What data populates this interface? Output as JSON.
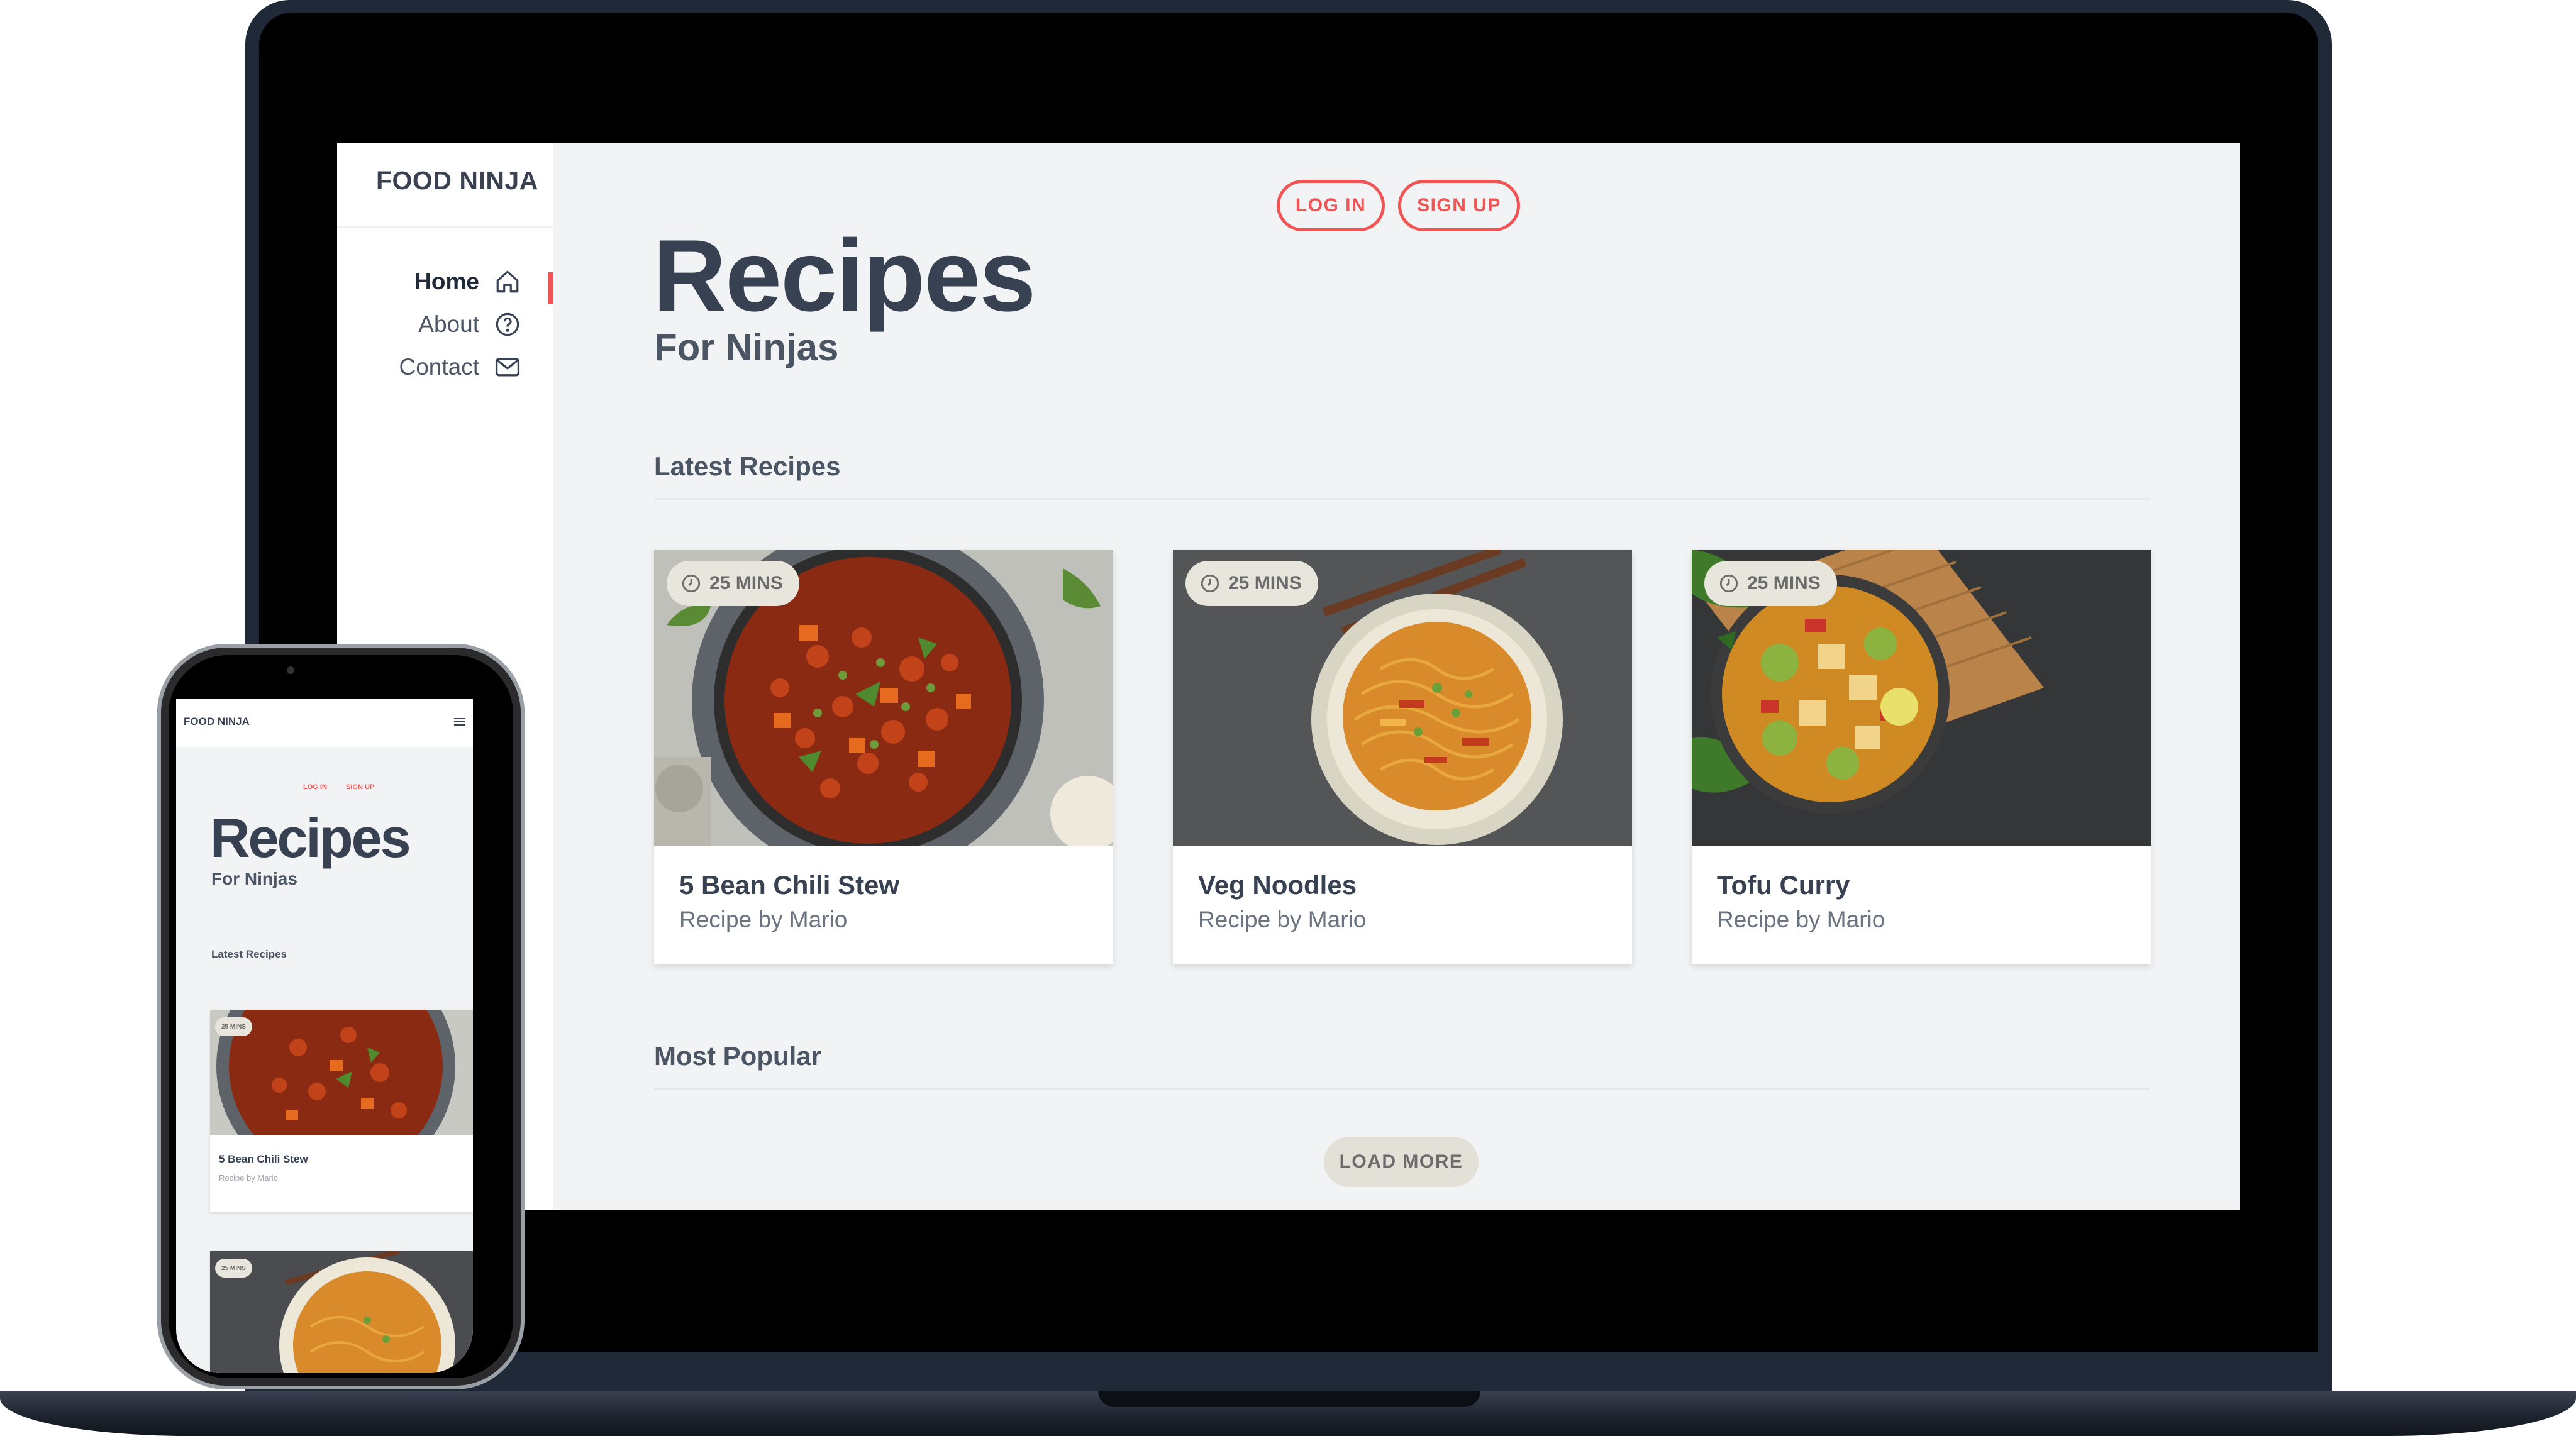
{
  "brand": "FOOD NINJA",
  "nav": [
    {
      "label": "Home",
      "icon": "home-icon",
      "active": true
    },
    {
      "label": "About",
      "icon": "question-circle-icon",
      "active": false
    },
    {
      "label": "Contact",
      "icon": "mail-icon",
      "active": false
    }
  ],
  "auth": {
    "login": "LOG IN",
    "signup": "SIGN UP"
  },
  "hero": {
    "title": "Recipes",
    "subtitle": "For Ninjas"
  },
  "sections": {
    "latest": "Latest Recipes",
    "popular": "Most Popular"
  },
  "recipes": [
    {
      "title": "5 Bean Chili Stew",
      "author": "Recipe by Mario",
      "time": "25 MINS"
    },
    {
      "title": "Veg Noodles",
      "author": "Recipe by Mario",
      "time": "25 MINS"
    },
    {
      "title": "Tofu Curry",
      "author": "Recipe by Mario",
      "time": "25 MINS"
    }
  ],
  "load_more": "LOAD MORE",
  "phone": {
    "brand": "FOOD NINJA",
    "login": "LOG IN",
    "signup": "SIGN UP",
    "title": "Recipes",
    "subtitle": "For Ninjas",
    "section": "Latest Recipes",
    "card1_title": "5 Bean Chili Stew",
    "card1_author": "Recipe by Mario",
    "card1_time": "25 MINS",
    "card2_time": "25 MINS"
  },
  "colors": {
    "accent": "#f05454",
    "text_dark": "#374151",
    "background": "#f2f3f5",
    "badge": "#e8e6dc"
  }
}
